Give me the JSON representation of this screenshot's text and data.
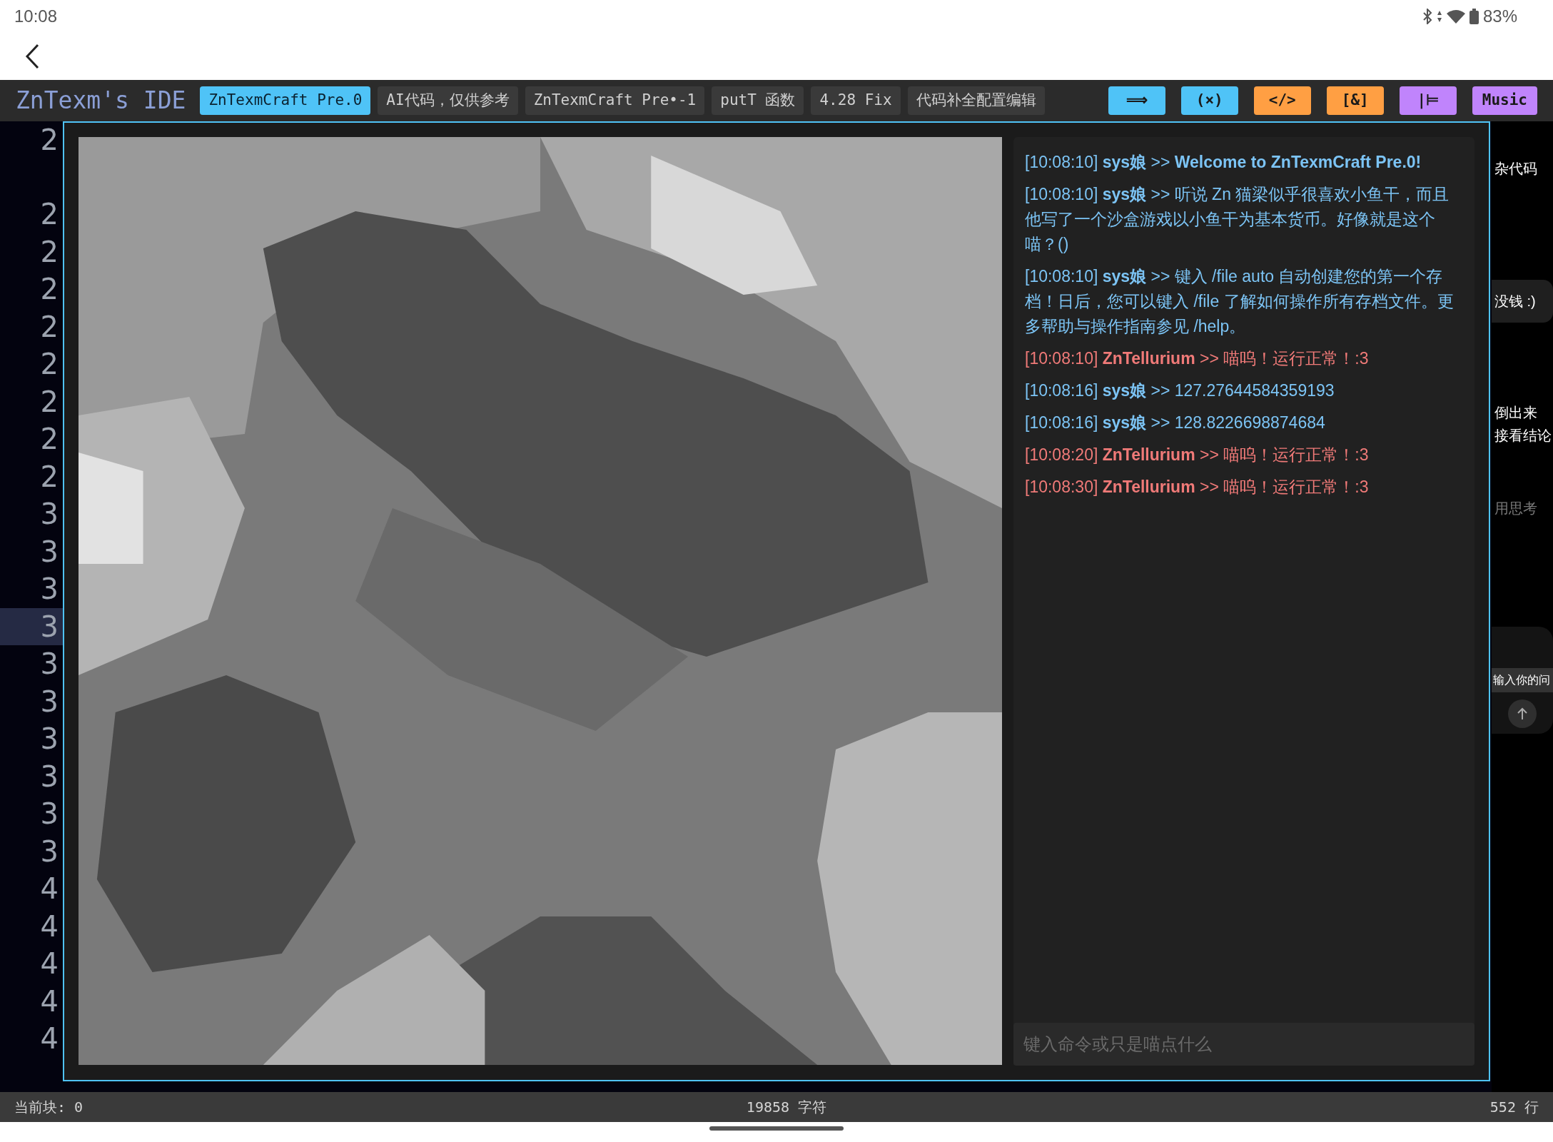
{
  "status_bar": {
    "time": "10:08",
    "battery": "83%"
  },
  "header": {
    "title": "ZnTexm's IDE"
  },
  "tabs": [
    {
      "label": "ZnTexmCraft Pre.0",
      "selected": true
    },
    {
      "label": "AI代码，仅供参考",
      "selected": false
    },
    {
      "label": "ZnTexmCraft Pre•-1",
      "selected": false
    },
    {
      "label": "putT 函数",
      "selected": false
    },
    {
      "label": "4.28 Fix",
      "selected": false
    },
    {
      "label": "代码补全配置编辑",
      "selected": false
    }
  ],
  "tools": [
    {
      "label": "⟹",
      "color": "#4fc3f7"
    },
    {
      "label": "(×)",
      "color": "#4fc3f7"
    },
    {
      "label": "</>",
      "color": "#ff9f43"
    },
    {
      "label": "[&]",
      "color": "#ff9f43"
    },
    {
      "label": "|⊨",
      "color": "#c084fc"
    },
    {
      "label": "Music",
      "color": "#c084fc"
    }
  ],
  "line_numbers": [
    {
      "number": "2",
      "selected": false
    },
    {
      "number": "2",
      "selected": false
    },
    {
      "number": "2",
      "selected": false
    },
    {
      "number": "2",
      "selected": false
    },
    {
      "number": "2",
      "selected": false
    },
    {
      "number": "2",
      "selected": false
    },
    {
      "number": "2",
      "selected": false
    },
    {
      "number": "2",
      "selected": false
    },
    {
      "number": "2",
      "selected": false
    },
    {
      "number": "3",
      "selected": false
    },
    {
      "number": "3",
      "selected": false
    },
    {
      "number": "3",
      "selected": false
    },
    {
      "number": "3",
      "selected": true
    },
    {
      "number": "3",
      "selected": false
    },
    {
      "number": "3",
      "selected": false
    },
    {
      "number": "3",
      "selected": false
    },
    {
      "number": "3",
      "selected": false
    },
    {
      "number": "3",
      "selected": false
    },
    {
      "number": "3",
      "selected": false
    },
    {
      "number": "4",
      "selected": false
    },
    {
      "number": "4",
      "selected": false
    },
    {
      "number": "4",
      "selected": false
    },
    {
      "number": "4",
      "selected": false
    },
    {
      "number": "4",
      "selected": false
    }
  ],
  "game": {
    "chat": {
      "messages": [
        {
          "kind": "system",
          "text": "[10:08:10] **sys娘** >> **Welcome to ZnTexmCraft Pre.0!**"
        },
        {
          "kind": "system",
          "text": "[10:08:10] **sys娘** >> 听说 Zn 猫梁似乎很喜欢小鱼干，而且他写了一个沙盒游戏以小鱼干为基本货币。好像就是这个喵？()"
        },
        {
          "kind": "system",
          "text": "[10:08:10] **sys娘** >> 键入 /file auto 自动创建您的第一个存档！日后，您可以键入 /file 了解如何操作所有存档文件。更多帮助与操作指南参见 /help。"
        },
        {
          "kind": "user",
          "text": "[10:08:10] **ZnTellurium** >> 喵呜！运行正常！:3"
        },
        {
          "kind": "system",
          "text": "[10:08:16] **sys娘** >> 127.27644584359193"
        },
        {
          "kind": "system",
          "text": "[10:08:16] **sys娘** >> 128.8226698874684"
        },
        {
          "kind": "user",
          "text": "[10:08:20] **ZnTellurium** >> 喵呜！运行正常！:3"
        },
        {
          "kind": "user",
          "text": "[10:08:30] **ZnTellurium** >> 喵呜！运行正常！:3"
        }
      ],
      "input": {
        "placeholder": "键入命令或只是喵点什么"
      }
    }
  },
  "side_panel": {
    "snippets": [
      {
        "kind": "plain",
        "text": "杂代码"
      },
      {
        "kind": "bubble",
        "text": "没钱 :)"
      },
      {
        "kind": "plain",
        "text": "倒出来"
      },
      {
        "kind": "plain",
        "text": "接看结论"
      },
      {
        "kind": "hint",
        "text": "用思考"
      }
    ],
    "input": {
      "placeholder": "输入你的问"
    }
  },
  "footer": {
    "current_block": "当前块: 0",
    "chars": "19858 字符",
    "lines": "552 行"
  }
}
